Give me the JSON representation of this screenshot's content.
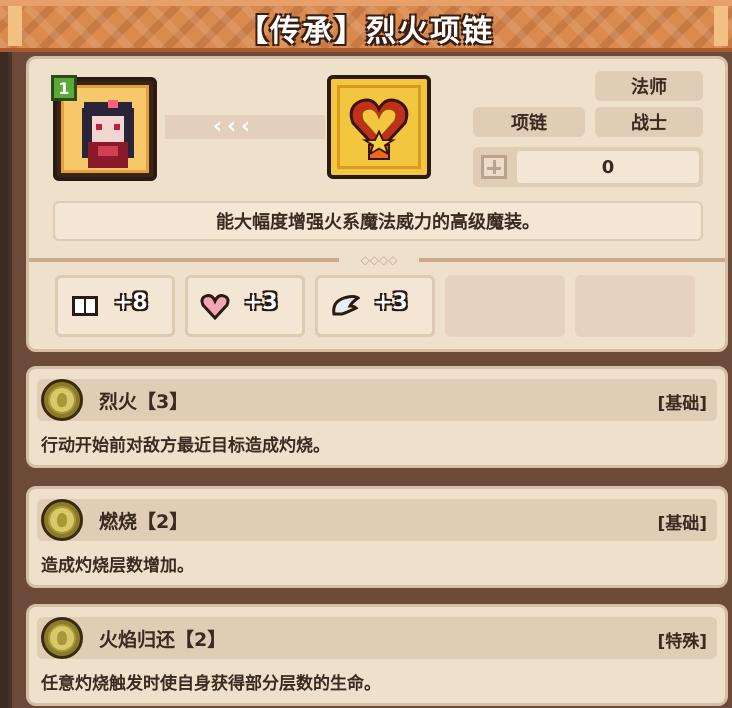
{
  "title": "【传承】烈火项链",
  "hero": {
    "level": "1"
  },
  "item": {
    "tags": {
      "mage": "法师",
      "slot": "项链",
      "warrior": "战士"
    },
    "stack_value": "0",
    "description": "能大幅度增强火系魔法威力的高级魔装。"
  },
  "stats": [
    {
      "icon": "book-icon",
      "value": "+8"
    },
    {
      "icon": "heart-icon",
      "value": "+3"
    },
    {
      "icon": "wing-icon",
      "value": "+3"
    }
  ],
  "skills": [
    {
      "name": "烈火【3】",
      "type": "[基础]",
      "desc": "行动开始前对敌方最近目标造成灼烧。"
    },
    {
      "name": "燃烧【2】",
      "type": "[基础]",
      "desc": "造成灼烧层数增加。"
    },
    {
      "name": "火焰归还【2】",
      "type": "[特殊]",
      "desc": "任意灼烧触发时使自身获得部分层数的生命。"
    }
  ],
  "colors": {
    "banner": "#d98a4f",
    "panel": "#efe0cc",
    "text": "#3a2a20"
  }
}
